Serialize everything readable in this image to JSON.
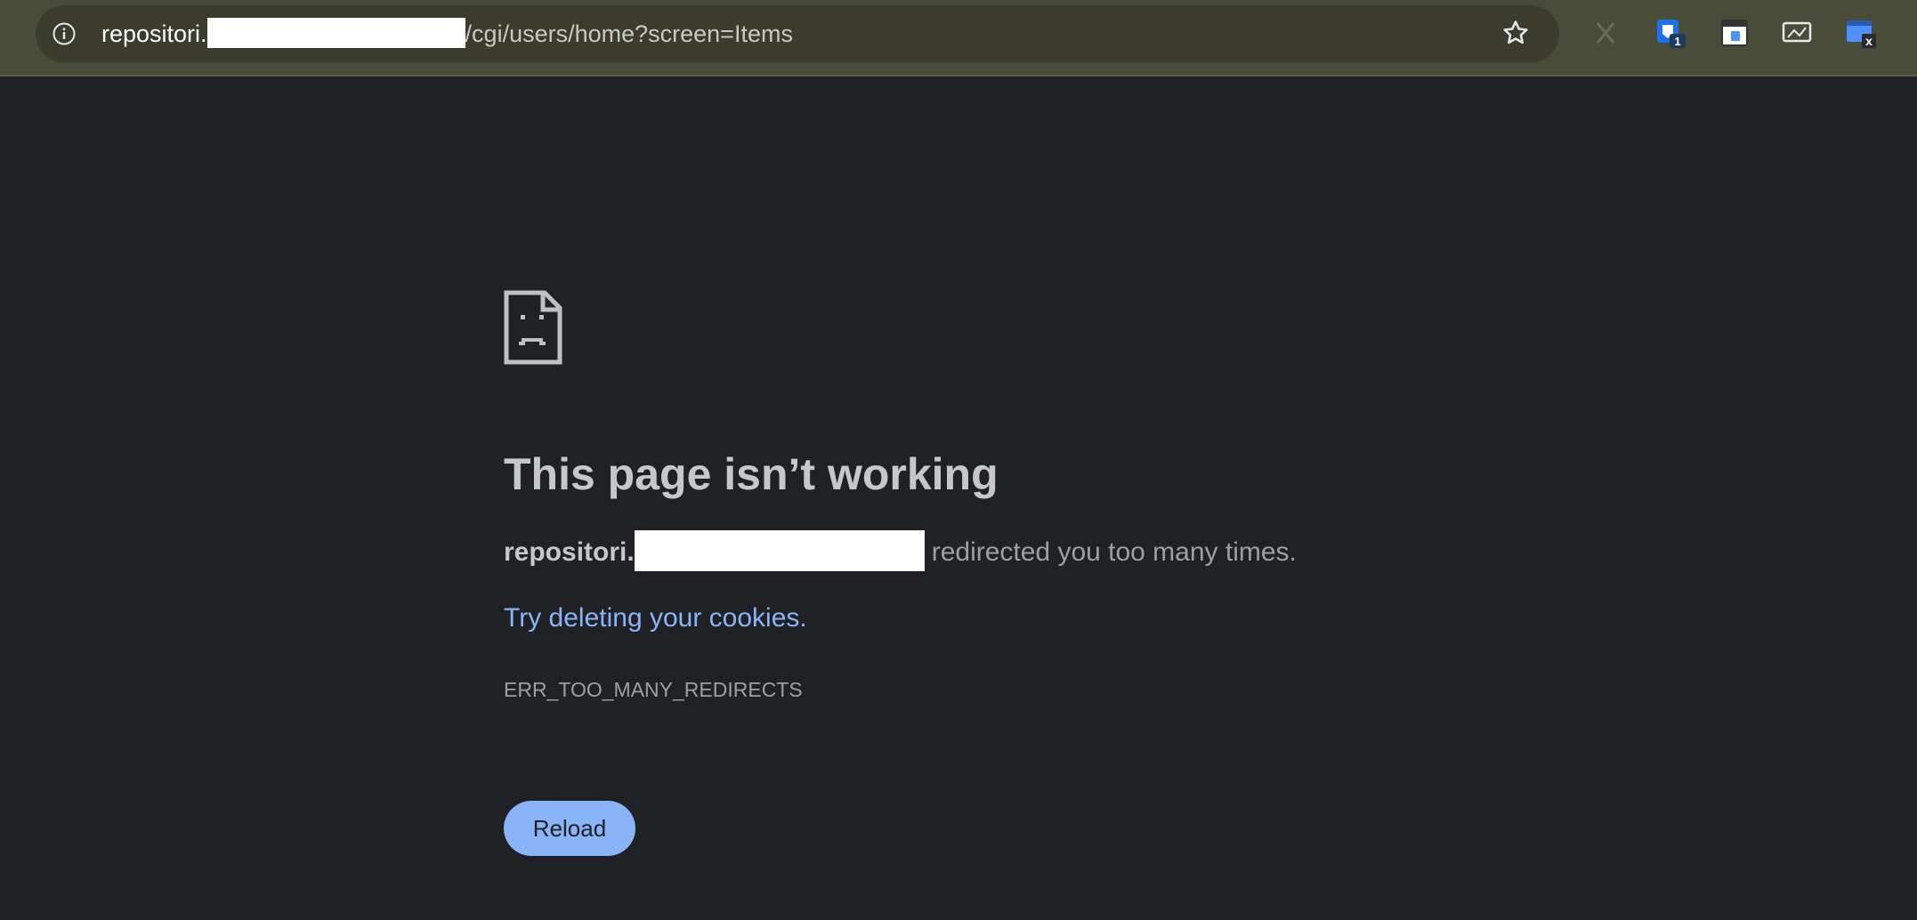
{
  "browser": {
    "url_host": "repositori.",
    "url_path": "/cgi/users/home?screen=Items",
    "extension_badges": {
      "ext2": "1",
      "ext5": "x"
    }
  },
  "error_page": {
    "heading": "This page isn’t working",
    "host_prefix": "repositori.",
    "detail_suffix": "redirected you too many times.",
    "suggestion_link": "Try deleting your cookies.",
    "error_code": "ERR_TOO_MANY_REDIRECTS",
    "reload_label": "Reload"
  },
  "colors": {
    "page_background": "#202124",
    "toolbar_background": "#4a4c3a",
    "link": "#8ab4f8",
    "button_background": "#8ab4f8"
  },
  "icons": [
    "info-icon",
    "bookmark-star-icon",
    "sad-page-icon"
  ]
}
